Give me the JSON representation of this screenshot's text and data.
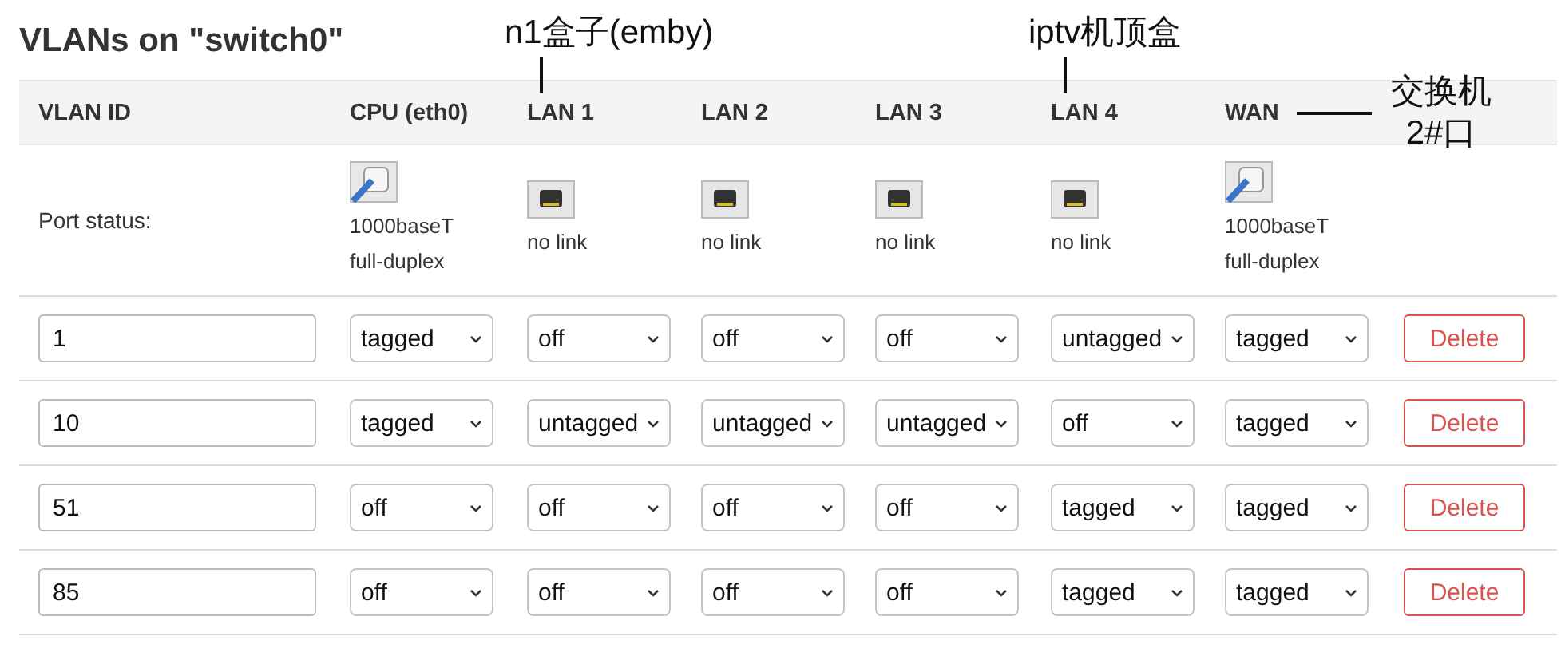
{
  "title": "VLANs on \"switch0\"",
  "columns": [
    {
      "label": "VLAN ID"
    },
    {
      "label": "CPU (eth0)"
    },
    {
      "label": "LAN 1",
      "annotation": {
        "kind": "above",
        "text": "n1盒子(emby)"
      }
    },
    {
      "label": "LAN 2"
    },
    {
      "label": "LAN 3"
    },
    {
      "label": "LAN 4",
      "annotation": {
        "kind": "above",
        "text": "iptv机顶盒"
      }
    },
    {
      "label": "WAN",
      "annotation": {
        "kind": "right",
        "lines": [
          "交换机",
          "2#口"
        ]
      }
    }
  ],
  "port_status": {
    "label": "Port status:",
    "ports": [
      {
        "kind": "link",
        "lines": [
          "1000baseT",
          "full-duplex"
        ]
      },
      {
        "kind": "nolink",
        "lines": [
          "no link"
        ]
      },
      {
        "kind": "nolink",
        "lines": [
          "no link"
        ]
      },
      {
        "kind": "nolink",
        "lines": [
          "no link"
        ]
      },
      {
        "kind": "nolink",
        "lines": [
          "no link"
        ]
      },
      {
        "kind": "link",
        "lines": [
          "1000baseT",
          "full-duplex"
        ]
      }
    ]
  },
  "rows": [
    {
      "vlan_id": "1",
      "ports": [
        "tagged",
        "off",
        "off",
        "off",
        "untagged",
        "tagged"
      ],
      "action": "Delete"
    },
    {
      "vlan_id": "10",
      "ports": [
        "tagged",
        "untagged",
        "untagged",
        "untagged",
        "off",
        "tagged"
      ],
      "action": "Delete"
    },
    {
      "vlan_id": "51",
      "ports": [
        "off",
        "off",
        "off",
        "off",
        "tagged",
        "tagged"
      ],
      "action": "Delete"
    },
    {
      "vlan_id": "85",
      "ports": [
        "off",
        "off",
        "off",
        "off",
        "tagged",
        "tagged"
      ],
      "action": "Delete"
    }
  ]
}
